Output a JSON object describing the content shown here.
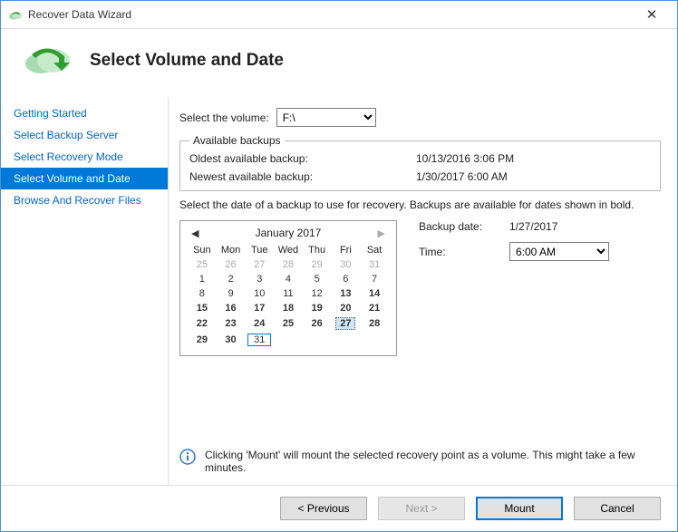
{
  "window": {
    "title": "Recover Data Wizard"
  },
  "header": {
    "title": "Select Volume and Date"
  },
  "sidebar": {
    "items": [
      {
        "label": "Getting Started"
      },
      {
        "label": "Select Backup Server"
      },
      {
        "label": "Select Recovery Mode"
      },
      {
        "label": "Select Volume and Date"
      },
      {
        "label": "Browse And Recover Files"
      }
    ],
    "active_index": 3
  },
  "volume": {
    "label": "Select the volume:",
    "selected": "F:\\"
  },
  "available": {
    "legend": "Available backups",
    "oldest_label": "Oldest available backup:",
    "oldest_value": "10/13/2016 3:06 PM",
    "newest_label": "Newest available backup:",
    "newest_value": "1/30/2017 6:00 AM"
  },
  "instructions": "Select the date of a backup to use for recovery. Backups are available for dates shown in bold.",
  "backup_date": {
    "label": "Backup date:",
    "value": "1/27/2017"
  },
  "time": {
    "label": "Time:",
    "value": "6:00 AM"
  },
  "calendar": {
    "month_label": "January 2017",
    "dow": [
      "Sun",
      "Mon",
      "Tue",
      "Wed",
      "Thu",
      "Fri",
      "Sat"
    ],
    "weeks": [
      [
        {
          "n": 25,
          "o": true
        },
        {
          "n": 26,
          "o": true
        },
        {
          "n": 27,
          "o": true
        },
        {
          "n": 28,
          "o": true
        },
        {
          "n": 29,
          "o": true
        },
        {
          "n": 30,
          "o": true
        },
        {
          "n": 31,
          "o": true
        }
      ],
      [
        {
          "n": 1
        },
        {
          "n": 2
        },
        {
          "n": 3
        },
        {
          "n": 4
        },
        {
          "n": 5
        },
        {
          "n": 6
        },
        {
          "n": 7
        }
      ],
      [
        {
          "n": 8
        },
        {
          "n": 9
        },
        {
          "n": 10
        },
        {
          "n": 11
        },
        {
          "n": 12
        },
        {
          "n": 13,
          "b": true
        },
        {
          "n": 14,
          "b": true
        }
      ],
      [
        {
          "n": 15,
          "b": true
        },
        {
          "n": 16,
          "b": true
        },
        {
          "n": 17,
          "b": true
        },
        {
          "n": 18,
          "b": true
        },
        {
          "n": 19,
          "b": true
        },
        {
          "n": 20,
          "b": true
        },
        {
          "n": 21,
          "b": true
        }
      ],
      [
        {
          "n": 22,
          "b": true
        },
        {
          "n": 23,
          "b": true
        },
        {
          "n": 24,
          "b": true
        },
        {
          "n": 25,
          "b": true
        },
        {
          "n": 26,
          "b": true
        },
        {
          "n": 27,
          "b": true,
          "sel": true
        },
        {
          "n": 28,
          "b": true
        }
      ],
      [
        {
          "n": 29,
          "b": true
        },
        {
          "n": 30,
          "b": true
        },
        {
          "n": 31,
          "today": true
        },
        {
          "n": ""
        },
        {
          "n": ""
        },
        {
          "n": ""
        },
        {
          "n": ""
        }
      ]
    ]
  },
  "info": {
    "text": "Clicking 'Mount' will mount the selected recovery point as a volume. This might take a few minutes."
  },
  "buttons": {
    "previous": "< Previous",
    "next": "Next >",
    "mount": "Mount",
    "cancel": "Cancel"
  }
}
